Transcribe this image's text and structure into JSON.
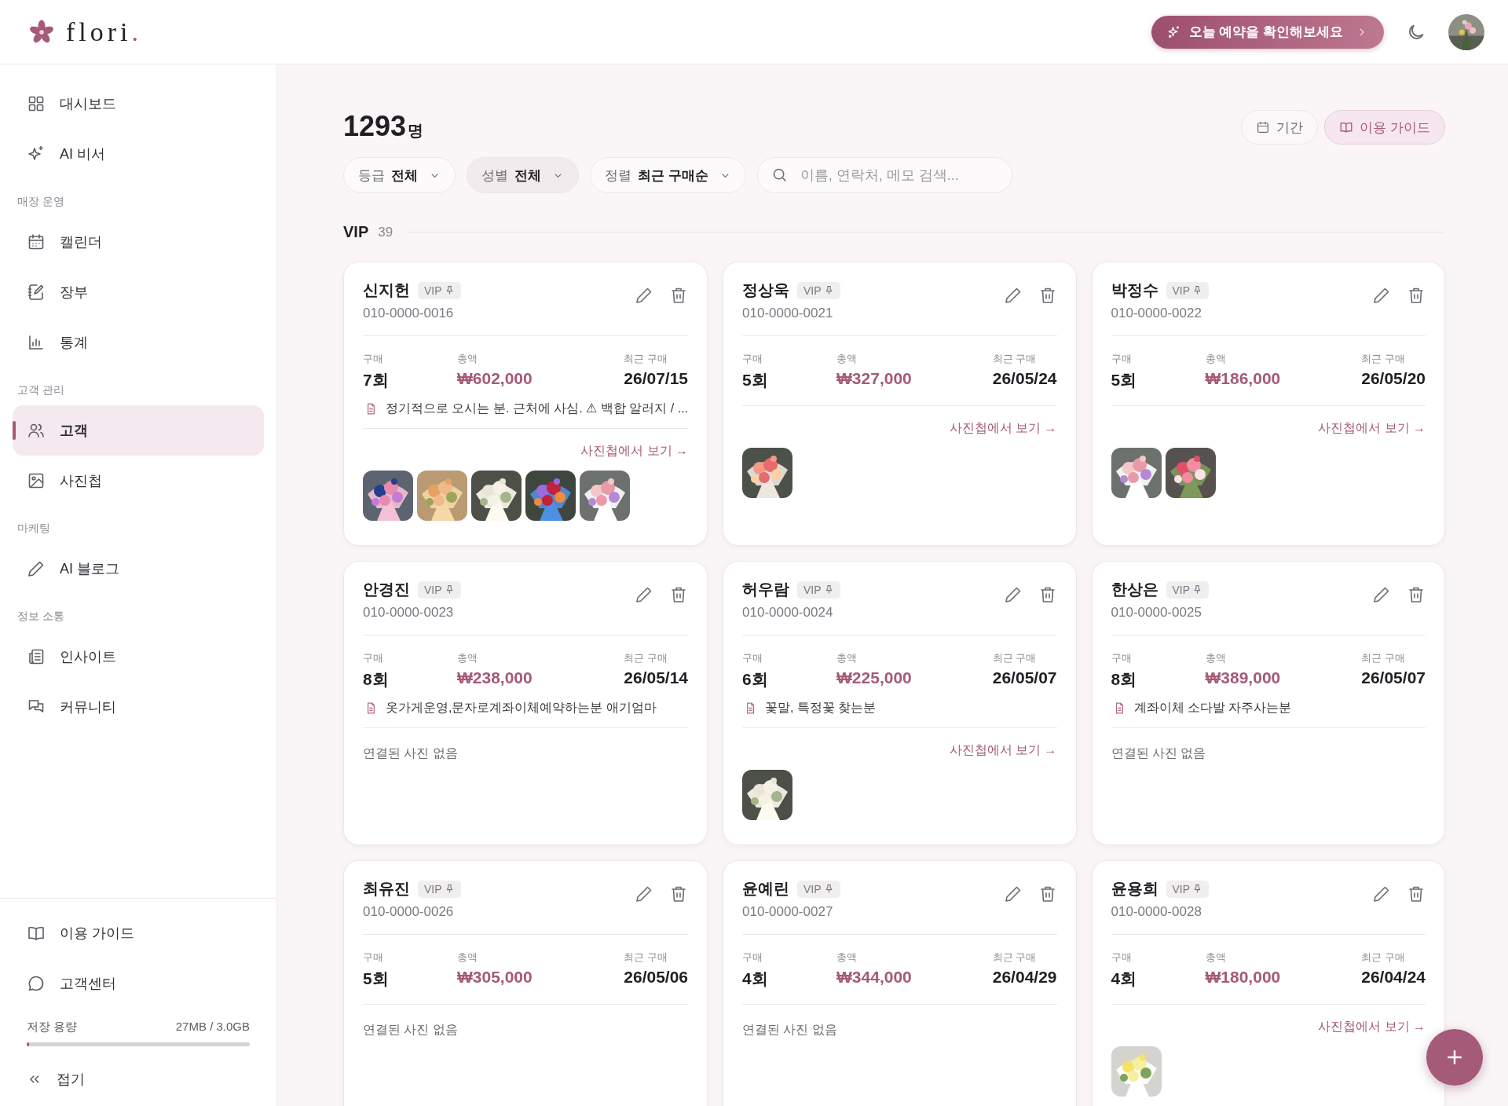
{
  "brand": {
    "name": "flori",
    "dot": "."
  },
  "header": {
    "cta": "오늘 예약을 확인해보세요"
  },
  "sidebar": {
    "groups": [
      {
        "items": [
          {
            "label": "대시보드",
            "selected": false
          },
          {
            "label": "AI 비서",
            "selected": false
          }
        ]
      },
      {
        "title": "매장 운영",
        "items": [
          {
            "label": "캘린더",
            "selected": false
          },
          {
            "label": "장부",
            "selected": false
          },
          {
            "label": "통계",
            "selected": false
          }
        ]
      },
      {
        "title": "고객 관리",
        "items": [
          {
            "label": "고객",
            "selected": true
          },
          {
            "label": "사진첩",
            "selected": false
          }
        ]
      },
      {
        "title": "마케팅",
        "items": [
          {
            "label": "AI 블로그",
            "selected": false
          }
        ]
      },
      {
        "title": "정보 소통",
        "items": [
          {
            "label": "인사이트",
            "selected": false
          },
          {
            "label": "커뮤니티",
            "selected": false
          }
        ]
      }
    ],
    "footer_items": [
      {
        "label": "이용 가이드"
      },
      {
        "label": "고객센터"
      }
    ],
    "storage": {
      "label": "저장 용량",
      "reading": "27MB / 3.0GB",
      "level": 0.01
    },
    "collapse": "접기"
  },
  "page": {
    "count": "1293",
    "unit": "명",
    "actions": [
      {
        "label": "기간",
        "selected": false
      },
      {
        "label": "이용 가이드",
        "selected": true
      }
    ],
    "filters": [
      {
        "label": "등급",
        "value": "전체",
        "selected": false
      },
      {
        "label": "성별",
        "value": "전체",
        "selected": true
      },
      {
        "label": "정렬",
        "value": "최근 구매순",
        "selected": false
      }
    ],
    "search": {
      "placeholder": "이름, 연락처, 메모 검색..."
    },
    "section": {
      "title": "VIP",
      "count": "39"
    }
  },
  "customers": [
    {
      "name": "신지헌",
      "badge": "VIP",
      "phone": "010-0000-0016",
      "stats": [
        {
          "label": "구매",
          "value": "7회",
          "kind": "count"
        },
        {
          "label": "총액",
          "value": "₩602,000",
          "kind": "amount"
        },
        {
          "label": "최근 구매",
          "value": "26/07/15",
          "kind": "date"
        }
      ],
      "memo": "정기적으로 오시는 분. 근처에 사심. ⚠ 백합 알러지 / ...",
      "link": "사진첩에서 보기 →"
    },
    {
      "name": "정상욱",
      "badge": "VIP",
      "phone": "010-0000-0021",
      "stats": [
        {
          "label": "구매",
          "value": "5회",
          "kind": "count"
        },
        {
          "label": "총액",
          "value": "₩327,000",
          "kind": "amount"
        },
        {
          "label": "최근 구매",
          "value": "26/05/24",
          "kind": "date"
        }
      ],
      "link": "사진첩에서 보기 →"
    },
    {
      "name": "박정수",
      "badge": "VIP",
      "phone": "010-0000-0022",
      "stats": [
        {
          "label": "구매",
          "value": "5회",
          "kind": "count"
        },
        {
          "label": "총액",
          "value": "₩186,000",
          "kind": "amount"
        },
        {
          "label": "최근 구매",
          "value": "26/05/20",
          "kind": "date"
        }
      ],
      "link": "사진첩에서 보기 →"
    },
    {
      "name": "안경진",
      "badge": "VIP",
      "phone": "010-0000-0023",
      "stats": [
        {
          "label": "구매",
          "value": "8회",
          "kind": "count"
        },
        {
          "label": "총액",
          "value": "₩238,000",
          "kind": "amount"
        },
        {
          "label": "최근 구매",
          "value": "26/05/14",
          "kind": "date"
        }
      ],
      "memo": "옷가게운영,문자로계좌이체예약하는분 애기엄마",
      "empty": "연결된 사진 없음"
    },
    {
      "name": "허우람",
      "badge": "VIP",
      "phone": "010-0000-0024",
      "stats": [
        {
          "label": "구매",
          "value": "6회",
          "kind": "count"
        },
        {
          "label": "총액",
          "value": "₩225,000",
          "kind": "amount"
        },
        {
          "label": "최근 구매",
          "value": "26/05/07",
          "kind": "date"
        }
      ],
      "memo": "꽃말, 특정꽃 찾는분",
      "link": "사진첩에서 보기 →"
    },
    {
      "name": "한상은",
      "badge": "VIP",
      "phone": "010-0000-0025",
      "stats": [
        {
          "label": "구매",
          "value": "8회",
          "kind": "count"
        },
        {
          "label": "총액",
          "value": "₩389,000",
          "kind": "amount"
        },
        {
          "label": "최근 구매",
          "value": "26/05/07",
          "kind": "date"
        }
      ],
      "memo": "계좌이체 소다발 자주사는분",
      "empty": "연결된 사진 없음"
    },
    {
      "name": "최유진",
      "badge": "VIP",
      "phone": "010-0000-0026",
      "stats": [
        {
          "label": "구매",
          "value": "5회",
          "kind": "count"
        },
        {
          "label": "총액",
          "value": "₩305,000",
          "kind": "amount"
        },
        {
          "label": "최근 구매",
          "value": "26/05/06",
          "kind": "date"
        }
      ],
      "empty": "연결된 사진 없음"
    },
    {
      "name": "윤예린",
      "badge": "VIP",
      "phone": "010-0000-0027",
      "stats": [
        {
          "label": "구매",
          "value": "4회",
          "kind": "count"
        },
        {
          "label": "총액",
          "value": "₩344,000",
          "kind": "amount"
        },
        {
          "label": "최근 구매",
          "value": "26/04/29",
          "kind": "date"
        }
      ],
      "empty": "연결된 사진 없음"
    },
    {
      "name": "윤용희",
      "badge": "VIP",
      "phone": "010-0000-0028",
      "stats": [
        {
          "label": "구매",
          "value": "4회",
          "kind": "count"
        },
        {
          "label": "총액",
          "value": "₩180,000",
          "kind": "amount"
        },
        {
          "label": "최근 구매",
          "value": "26/04/24",
          "kind": "date"
        }
      ],
      "link": "사진첩에서 보기 →"
    }
  ]
}
